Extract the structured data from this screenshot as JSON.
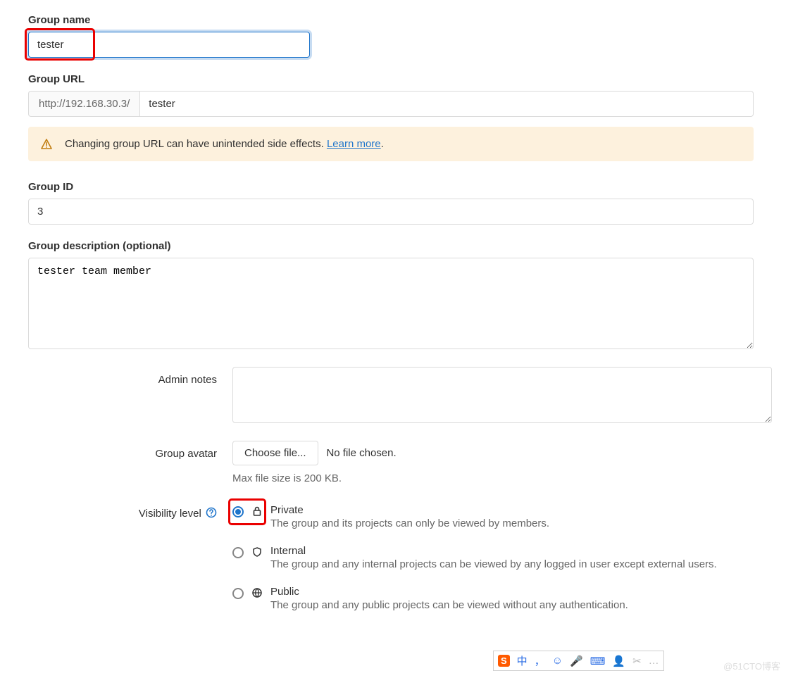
{
  "group_name": {
    "label": "Group name",
    "value": "tester"
  },
  "group_url": {
    "label": "Group URL",
    "prefix": "http://192.168.30.3/",
    "value": "tester"
  },
  "warning": {
    "text": "Changing group URL can have unintended side effects.",
    "link_text": "Learn more"
  },
  "group_id": {
    "label": "Group ID",
    "value": "3"
  },
  "group_description": {
    "label": "Group description (optional)",
    "value": "tester team member"
  },
  "admin_notes": {
    "label": "Admin notes",
    "value": ""
  },
  "group_avatar": {
    "label": "Group avatar",
    "button": "Choose file...",
    "status": "No file chosen.",
    "hint": "Max file size is 200 KB."
  },
  "visibility": {
    "label": "Visibility level",
    "options": [
      {
        "value": "private",
        "title": "Private",
        "desc": "The group and its projects can only be viewed by members.",
        "checked": true
      },
      {
        "value": "internal",
        "title": "Internal",
        "desc": "The group and any internal projects can be viewed by any logged in user except external users.",
        "checked": false
      },
      {
        "value": "public",
        "title": "Public",
        "desc": "The group and any public projects can be viewed without any authentication.",
        "checked": false
      }
    ]
  },
  "watermark": "@51CTO博客",
  "ime_items": [
    "中",
    "，",
    "☺",
    "🎤",
    "⌨",
    "👤",
    "✂",
    "…"
  ]
}
